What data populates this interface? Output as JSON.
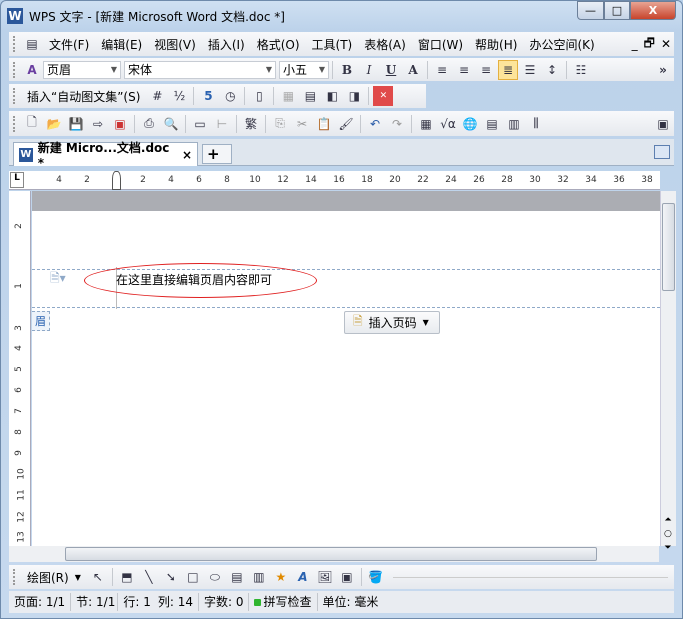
{
  "window": {
    "title": "WPS 文字 - [新建 Microsoft Word 文档.doc *]",
    "logo": "W",
    "min": "—",
    "max": "□",
    "close": "X"
  },
  "menu": [
    "文件(F)",
    "编辑(E)",
    "视图(V)",
    "插入(I)",
    "格式(O)",
    "工具(T)",
    "表格(A)",
    "窗口(W)",
    "帮助(H)",
    "办公空间(K)"
  ],
  "menu_right": [
    "_",
    "🗗",
    "✕"
  ],
  "format": {
    "style": "页眉",
    "font": "宋体",
    "size": "小五",
    "bold": "B",
    "italic": "I",
    "underline": "U",
    "fontcolor": "A",
    "more": "»"
  },
  "autotext": {
    "label": "插入“自动图文集”(S)"
  },
  "tab": {
    "label": "新建 Micro...文档.doc *",
    "close": "×",
    "add": "+"
  },
  "hruler": [
    "4",
    "2",
    "2",
    "4",
    "6",
    "8",
    "10",
    "12",
    "14",
    "16",
    "18",
    "20",
    "22",
    "24",
    "26",
    "28",
    "30",
    "32",
    "34",
    "36",
    "38"
  ],
  "vruler": [
    "2",
    "1",
    "3",
    "4",
    "5",
    "6",
    "7",
    "8",
    "9",
    "10",
    "11",
    "12",
    "13"
  ],
  "doc": {
    "header_text": "在这里直接编辑页眉内容即可",
    "header_tag": "眉",
    "insert_page_num": "插入页码"
  },
  "draw": {
    "label": "绘图(R)"
  },
  "status": {
    "page": "页面: 1/1",
    "section": "节: 1/1",
    "row": "行: 1",
    "col": "列: 14",
    "words": "字数: 0",
    "spell": "拼写检查",
    "unit": "单位: 毫米"
  }
}
